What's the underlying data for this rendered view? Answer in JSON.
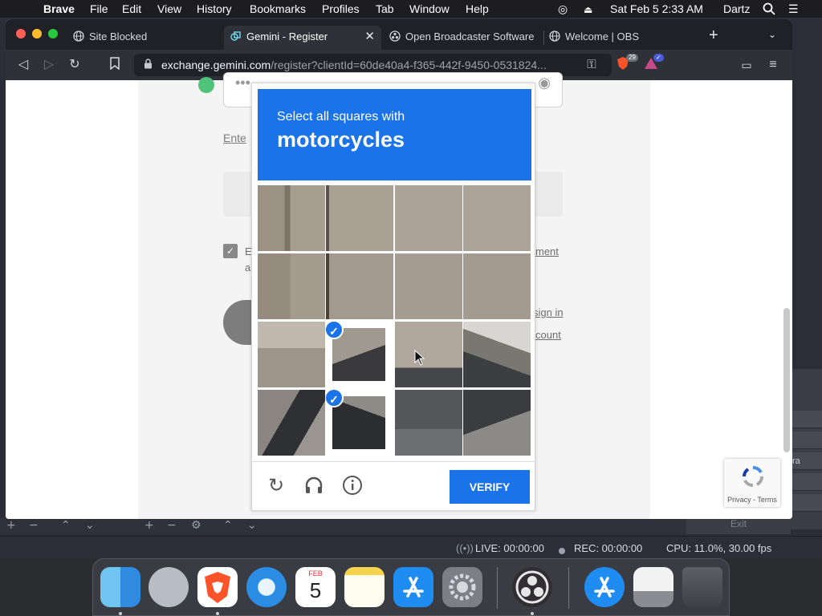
{
  "menubar": {
    "app": "Brave",
    "items": [
      "File",
      "Edit",
      "View",
      "History",
      "Bookmarks",
      "Profiles",
      "Tab",
      "Window",
      "Help"
    ],
    "clock": "Sat Feb 5  2:33 AM",
    "user": "Dartz"
  },
  "tabs": [
    {
      "label": "Site Blocked",
      "icon": "globe-icon",
      "active": false
    },
    {
      "label": "Gemini - Register",
      "icon": "gemini-icon",
      "active": true
    },
    {
      "label": "Open Broadcaster Software",
      "icon": "obs-icon",
      "active": false
    },
    {
      "label": "Welcome | OBS",
      "icon": "globe-icon",
      "active": false
    }
  ],
  "toolbar": {
    "url_host": "exchange.gemini.com",
    "url_path": "/register?clientId=60de40a4-f365-442f-9450-0531824...",
    "brave_badge": "29"
  },
  "page": {
    "enter_text": "Ente",
    "agree_initial": "E",
    "agree_second_line": "a",
    "link_partial_1": "ment",
    "link_sign_in": "sign in",
    "link_account": "count"
  },
  "captcha": {
    "prompt": "Select all squares with",
    "target": "motorcycles",
    "verify_label": "VERIFY",
    "selected_tiles": [
      9,
      13
    ]
  },
  "recaptcha_badge": {
    "text": "Privacy - Terms"
  },
  "obs": {
    "live": "LIVE: 00:00:00",
    "rec": "REC: 00:00:00",
    "cpu": "CPU: 11.0%, 30.00 fps",
    "exit": "Exit",
    "side_label": "ra"
  },
  "dock": {
    "calendar_month": "FEB",
    "calendar_day": "5"
  },
  "colors": {
    "captcha_blue": "#1a73e8",
    "menubar": "#1d1d20",
    "tabbar": "#1f2126"
  }
}
